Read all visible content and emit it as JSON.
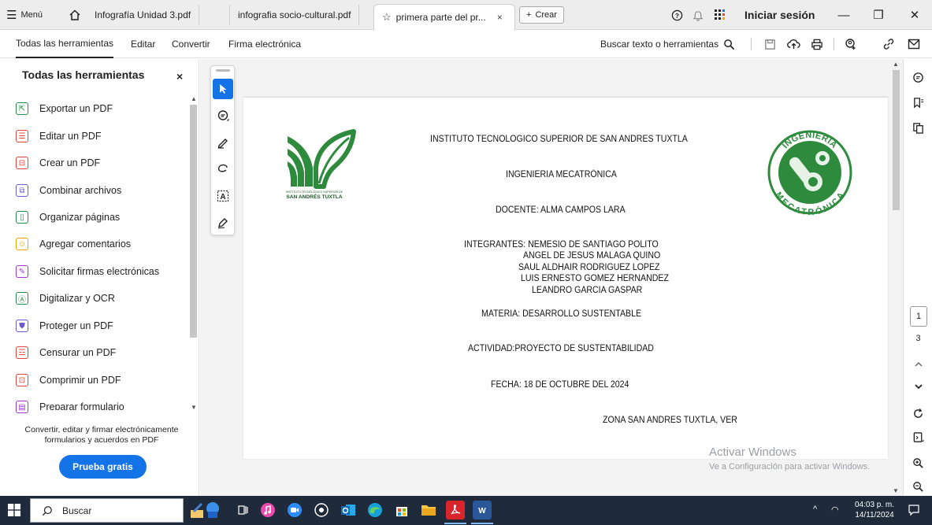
{
  "titlebar": {
    "menu_label": "Menú",
    "tabs": [
      {
        "label": "Infografía Unidad 3.pdf"
      },
      {
        "label": "infografia socio-cultural.pdf"
      },
      {
        "label": "primera parte del pr...",
        "close": "×"
      }
    ],
    "new_tab_label": "Crear",
    "sign_in_label": "Iniciar sesión",
    "win_minimize": "—",
    "win_maximize": "❐",
    "win_close": "✕"
  },
  "menubar": {
    "items": [
      "Todas las herramientas",
      "Editar",
      "Convertir",
      "Firma electrónica"
    ],
    "search_label": "Buscar texto o herramientas"
  },
  "left_panel": {
    "title": "Todas las herramientas",
    "close": "×",
    "tools": [
      {
        "label": "Exportar un PDF",
        "icon": "export-pdf-icon",
        "color": "#2a8a4a"
      },
      {
        "label": "Editar un PDF",
        "icon": "edit-pdf-icon",
        "color": "#e0443e"
      },
      {
        "label": "Crear un PDF",
        "icon": "create-pdf-icon",
        "color": "#e0443e"
      },
      {
        "label": "Combinar archivos",
        "icon": "combine-files-icon",
        "color": "#6b5bd2"
      },
      {
        "label": "Organizar páginas",
        "icon": "organize-pages-icon",
        "color": "#2a8a4a"
      },
      {
        "label": "Agregar comentarios",
        "icon": "add-comment-icon",
        "color": "#e8a800"
      },
      {
        "label": "Solicitar firmas electrónicas",
        "icon": "request-signature-icon",
        "color": "#a03ac6"
      },
      {
        "label": "Digitalizar y OCR",
        "icon": "scan-ocr-icon",
        "color": "#2a8a4a"
      },
      {
        "label": "Proteger un PDF",
        "icon": "protect-pdf-icon",
        "color": "#6b5bd2"
      },
      {
        "label": "Censurar un PDF",
        "icon": "redact-pdf-icon",
        "color": "#e0443e"
      },
      {
        "label": "Comprimir un PDF",
        "icon": "compress-pdf-icon",
        "color": "#e0443e"
      },
      {
        "label": "Preparar formulario",
        "icon": "prepare-form-icon",
        "color": "#a03ac6"
      }
    ],
    "promo_text": "Convertir, editar y firmar electrónicamente formularios y acuerdos en PDF",
    "trial_button": "Prueba gratis"
  },
  "document": {
    "institute": "INSTITUTO TECNOLOGICO SUPERIOR DE SAN ANDRES TUXTLA",
    "career": "INGENIERIA MECATRÓNICA",
    "teacher": "DOCENTE: ALMA CAMPOS LARA",
    "members": [
      "INTEGRANTES: NEMESIO DE SANTIAGO POLITO",
      "ANGEL DE JESUS MALAGA QUINO",
      "SAUL ALDHAIR RODRIGUEZ LOPEZ",
      "LUIS ERNESTO GOMEZ HERNANDEZ",
      "LEANDRO GARCIA GASPAR"
    ],
    "subject": "MATERIA: DESARROLLO SUSTENTABLE",
    "activity": "ACTIVIDAD:PROYECTO DE SUSTENTABILIDAD",
    "date": "FECHA: 18 DE OCTUBRE DEL 2024",
    "zone": "ZONA SAN ANDRES TUXTLA, VER",
    "logo_left_caption_small": "INSTITUTO TECNOLÓGICO SUPERIOR DE",
    "logo_left_caption": "SAN ANDRÉS TUXTLA",
    "logo_right_top": "INGENIERÍA",
    "logo_right_bottom": "MECATRÓNICA"
  },
  "watermark": {
    "line1": "Activar Windows",
    "line2": "Ve a Configuración para activar Windows."
  },
  "right_rail": {
    "current_page": "1",
    "total_pages": "3"
  },
  "taskbar": {
    "search_label": "Buscar",
    "time": "04:03 p. m.",
    "date": "14/11/2024"
  },
  "colors": {
    "accent": "#1473e6",
    "logo_green": "#2e8b3e",
    "taskbar": "#1f2a3a"
  }
}
